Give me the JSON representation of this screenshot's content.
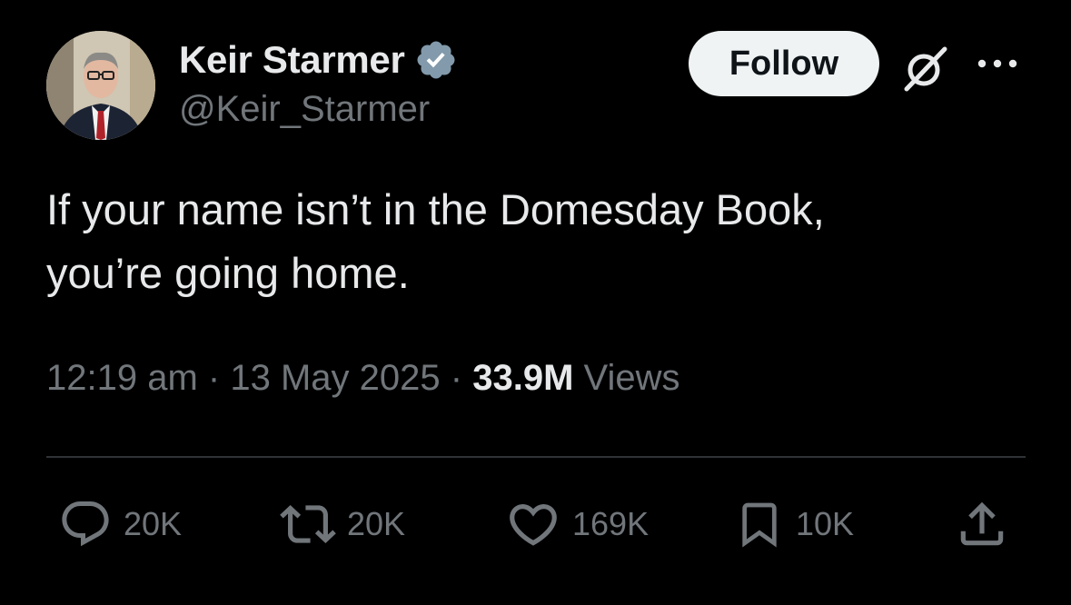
{
  "author": {
    "name": "Keir Starmer",
    "handle": "@Keir_Starmer",
    "verified_color": "#829aab"
  },
  "header": {
    "follow_label": "Follow",
    "icons": [
      "grok-icon",
      "more-options-icon"
    ]
  },
  "tweet": {
    "text": "If your name isn’t in the Domesday Book,\nyou’re going home."
  },
  "meta": {
    "time": "12:19 am",
    "separator": "·",
    "date": "13 May 2025",
    "views_count": "33.9M",
    "views_label": "Views"
  },
  "actions": {
    "replies": "20K",
    "reposts": "20K",
    "likes": "169K",
    "bookmarks": "10K"
  },
  "colors": {
    "background": "#000000",
    "text_primary": "#e7e9ea",
    "text_secondary": "#71767b",
    "divider": "#2f3336",
    "follow_bg": "#eff3f4"
  }
}
